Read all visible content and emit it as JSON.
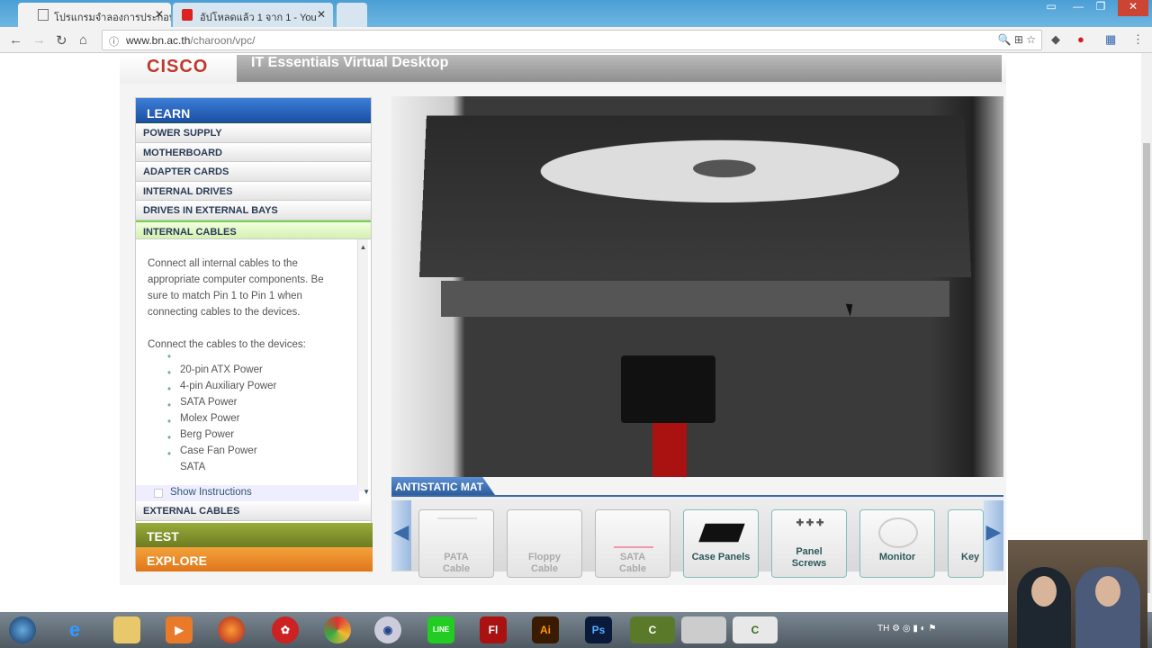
{
  "browser": {
    "tabs": [
      {
        "title": "โปรแกรมจำลองการประกอบ",
        "icon": "page-icon",
        "active": true
      },
      {
        "title": "อัปโหลดแล้ว 1 จาก 1 - You",
        "icon": "youtube-icon",
        "active": false
      }
    ],
    "url_domain": "www.bn.ac.th",
    "url_path": "/charoon/vpc/"
  },
  "header": {
    "logo": "CISCO",
    "title": "IT Essentials Virtual Desktop"
  },
  "sidebar": {
    "learn_label": "LEARN",
    "items": [
      "POWER SUPPLY",
      "MOTHERBOARD",
      "ADAPTER CARDS",
      "INTERNAL DRIVES",
      "DRIVES IN EXTERNAL BAYS",
      "INTERNAL CABLES"
    ],
    "active_item": "INTERNAL CABLES",
    "instructions": {
      "para1": "Connect all internal cables to the appropriate computer components. Be sure to match Pin 1 to Pin 1 when connecting cables to the devices.",
      "para2": "Connect the cables to the devices:",
      "list": [
        "20-pin ATX Power",
        "4-pin Auxiliary Power",
        "SATA Power",
        "Molex Power",
        "Berg Power",
        "Case Fan Power",
        "SATA"
      ]
    },
    "show_instructions": "Show Instructions",
    "external_cables": "EXTERNAL CABLES",
    "test_label": "TEST",
    "explore_label": "EXPLORE",
    "colors": {
      "learn": "#1c4fa4",
      "test": "#7a8a2a",
      "explore": "#e8821e",
      "active": "#7ad14c"
    }
  },
  "workspace": {
    "mat_label": "ANTISTATIC MAT",
    "tray_items": [
      {
        "label1": "PATA",
        "label2": "Cable",
        "enabled": false
      },
      {
        "label1": "Floppy",
        "label2": "Cable",
        "enabled": false
      },
      {
        "label1": "SATA",
        "label2": "Cable",
        "enabled": false
      },
      {
        "label1": "",
        "label2": "Case Panels",
        "enabled": true
      },
      {
        "label1": "Panel",
        "label2": "Screws",
        "enabled": true
      },
      {
        "label1": "",
        "label2": "Monitor",
        "enabled": true
      },
      {
        "label1": "",
        "label2": "Key",
        "enabled": true
      }
    ]
  },
  "taskbar": {
    "apps": [
      "start",
      "ie",
      "explorer",
      "media-player",
      "firefox",
      "app-red",
      "chrome",
      "app-blue",
      "LINE",
      "Fl",
      "Ai",
      "Ps",
      "C",
      "doc",
      "C"
    ],
    "lang": "TH"
  }
}
